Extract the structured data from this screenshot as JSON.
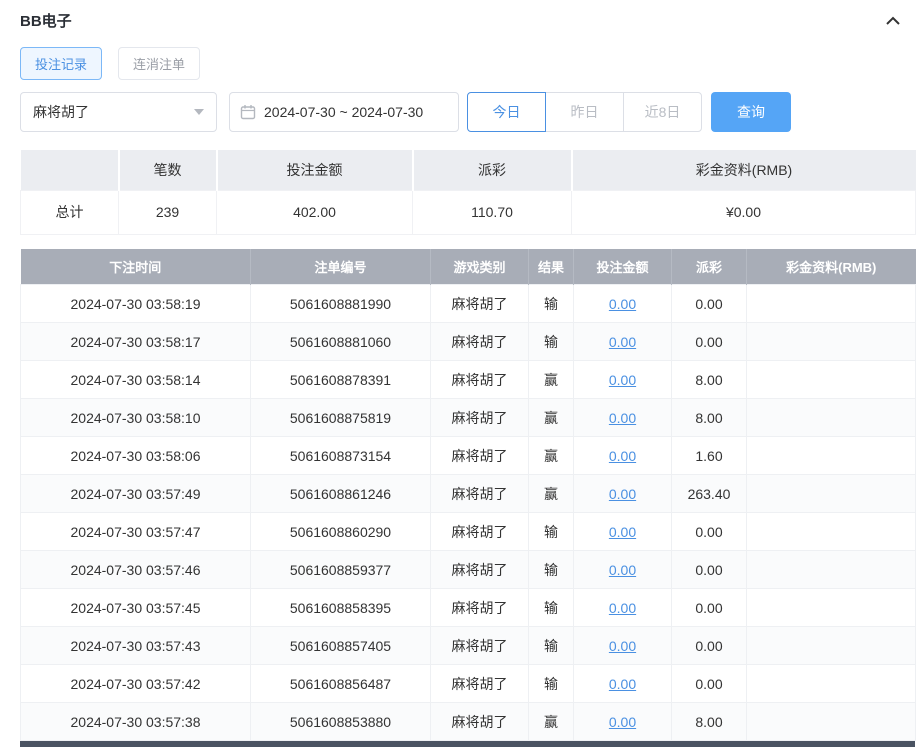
{
  "header": {
    "title": "BB电子"
  },
  "tabs": {
    "bet_records": "投注记录",
    "cancelled_orders": "连消注单"
  },
  "filters": {
    "game": "麻将胡了",
    "date_range": "2024-07-30 ~ 2024-07-30",
    "today": "今日",
    "yesterday": "昨日",
    "last8days": "近8日",
    "search": "查询"
  },
  "summary": {
    "headers": [
      "",
      "笔数",
      "投注金额",
      "派彩",
      "彩金资料(RMB)"
    ],
    "total_label": "总计",
    "count": "239",
    "bet_amount": "402.00",
    "payout": "110.70",
    "bonus": "¥0.00"
  },
  "records_table": {
    "headers": [
      "下注时间",
      "注单编号",
      "游戏类别",
      "结果",
      "投注金额",
      "派彩",
      "彩金资料(RMB)"
    ],
    "rows": [
      {
        "time": "2024-07-30 03:58:19",
        "order_id": "5061608881990",
        "game": "麻将胡了",
        "result": "输",
        "bet": "0.00",
        "payout": "0.00",
        "bonus": ""
      },
      {
        "time": "2024-07-30 03:58:17",
        "order_id": "5061608881060",
        "game": "麻将胡了",
        "result": "输",
        "bet": "0.00",
        "payout": "0.00",
        "bonus": ""
      },
      {
        "time": "2024-07-30 03:58:14",
        "order_id": "5061608878391",
        "game": "麻将胡了",
        "result": "赢",
        "bet": "0.00",
        "payout": "8.00",
        "bonus": ""
      },
      {
        "time": "2024-07-30 03:58:10",
        "order_id": "5061608875819",
        "game": "麻将胡了",
        "result": "赢",
        "bet": "0.00",
        "payout": "8.00",
        "bonus": ""
      },
      {
        "time": "2024-07-30 03:58:06",
        "order_id": "5061608873154",
        "game": "麻将胡了",
        "result": "赢",
        "bet": "0.00",
        "payout": "1.60",
        "bonus": ""
      },
      {
        "time": "2024-07-30 03:57:49",
        "order_id": "5061608861246",
        "game": "麻将胡了",
        "result": "赢",
        "bet": "0.00",
        "payout": "263.40",
        "bonus": ""
      },
      {
        "time": "2024-07-30 03:57:47",
        "order_id": "5061608860290",
        "game": "麻将胡了",
        "result": "输",
        "bet": "0.00",
        "payout": "0.00",
        "bonus": ""
      },
      {
        "time": "2024-07-30 03:57:46",
        "order_id": "5061608859377",
        "game": "麻将胡了",
        "result": "输",
        "bet": "0.00",
        "payout": "0.00",
        "bonus": ""
      },
      {
        "time": "2024-07-30 03:57:45",
        "order_id": "5061608858395",
        "game": "麻将胡了",
        "result": "输",
        "bet": "0.00",
        "payout": "0.00",
        "bonus": ""
      },
      {
        "time": "2024-07-30 03:57:43",
        "order_id": "5061608857405",
        "game": "麻将胡了",
        "result": "输",
        "bet": "0.00",
        "payout": "0.00",
        "bonus": ""
      },
      {
        "time": "2024-07-30 03:57:42",
        "order_id": "5061608856487",
        "game": "麻将胡了",
        "result": "输",
        "bet": "0.00",
        "payout": "0.00",
        "bonus": ""
      },
      {
        "time": "2024-07-30 03:57:38",
        "order_id": "5061608853880",
        "game": "麻将胡了",
        "result": "赢",
        "bet": "0.00",
        "payout": "8.00",
        "bonus": ""
      }
    ]
  },
  "colors": {
    "accent": "#4a90e2",
    "primary_button": "#55a5f6",
    "records_header_bg": "#a8adb7",
    "summary_header_bg": "#ebedf1",
    "link": "#4a90e2",
    "next_section_bar": "#4a5362"
  }
}
